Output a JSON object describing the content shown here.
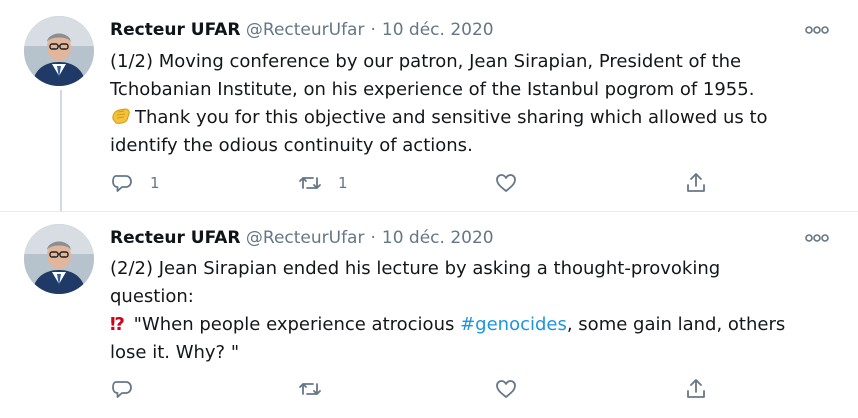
{
  "tweets": [
    {
      "author_name": "Recteur UFAR",
      "handle": "@RecteurUfar",
      "separator": "·",
      "date": "10 déc. 2020",
      "line1": "(1/2) Moving conference by our patron, Jean Sirapian, President of the",
      "line2": "Tchobanian Institute, on his experience of the Istanbul pogrom of 1955.",
      "line3_emoji": "clapping-hands-emoji",
      "line3": "Thank you for this objective and sensitive sharing which allowed us to",
      "line4": "identify the odious continuity of actions.",
      "reply_count": "1",
      "retweet_count": "1",
      "like_count": "",
      "avatar_icon": "profile-photo-man-with-glasses"
    },
    {
      "author_name": "Recteur UFAR",
      "handle": "@RecteurUfar",
      "separator": "·",
      "date": "10 déc. 2020",
      "line1": "(2/2) Jean Sirapian ended his lecture by asking a thought-provoking",
      "line2": "question:",
      "line3_prefix": "⁉",
      "line3_text": " \"When people experience atrocious ",
      "hashtag": "#genocides",
      "line3_suffix": ", some gain land, others",
      "line4": "lose it. Why? \"",
      "reply_count": "",
      "retweet_count": "",
      "like_count": "",
      "avatar_icon": "profile-photo-man-with-glasses"
    }
  ],
  "icons": {
    "more": "more-options-icon",
    "reply": "reply-icon",
    "retweet": "retweet-icon",
    "like": "like-heart-icon",
    "share": "share-icon"
  },
  "colors": {
    "text": "#0f1419",
    "muted": "#657786",
    "hashtag": "#1b95e0",
    "interrobang": "#d0021b",
    "divider": "#e6ecf0"
  }
}
